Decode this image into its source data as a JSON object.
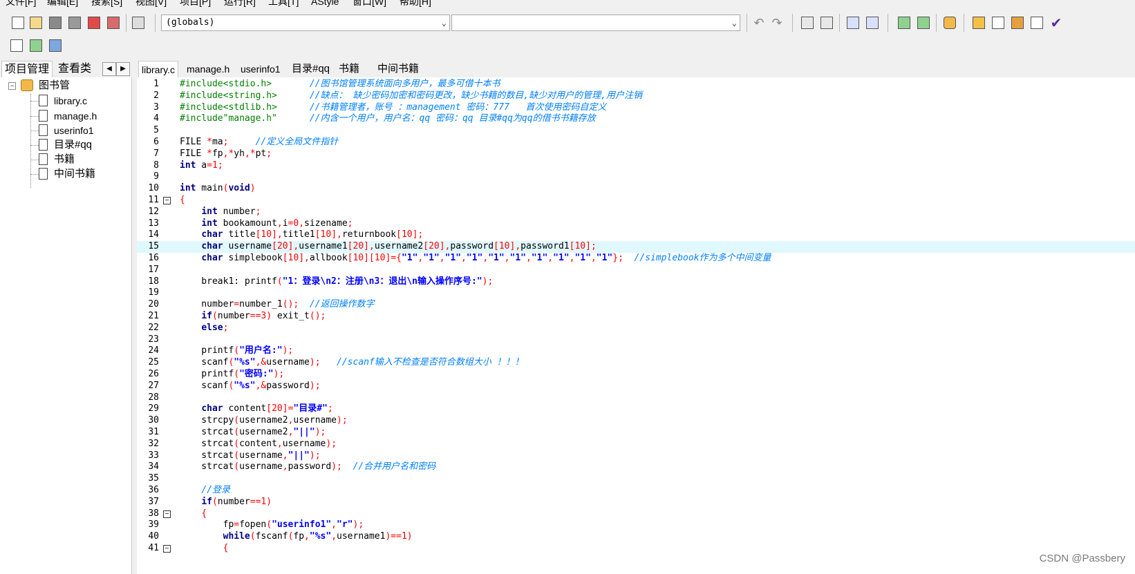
{
  "menu": [
    "文件[F]",
    "编辑[E]",
    "搜索[S]",
    "视图[V]",
    "项目[P]",
    "运行[R]",
    "工具[T]",
    "AStyle",
    "窗口[W]",
    "帮助[H]"
  ],
  "toolbar": {
    "scope_combo": "(globals)",
    "symbol_combo": ""
  },
  "left_panel": {
    "tabs": [
      "项目管理",
      "查看类"
    ],
    "nav_prev": "◀",
    "nav_next": "▶",
    "project_name": "图书管",
    "files": [
      "library.c",
      "manage.h",
      "userinfo1",
      "目录#qq",
      "书籍",
      "中间书籍"
    ]
  },
  "editor_tabs": [
    "library.c",
    "manage.h",
    "userinfo1",
    "目录#qq",
    "书籍",
    "中间书籍"
  ],
  "active_tab": "library.c",
  "code_lines": [
    "#include<stdio.h>       //图书馆管理系统面向多用户，最多可借十本书",
    "#include<string.h>      //缺点： 缺少密码加密和密码更改，缺少书籍的数目,缺少对用户的管理,用户注销",
    "#include<stdlib.h>      //书籍管理者，账号 ：management 密码：777   首次使用密码自定义",
    "#include\"manage.h\"      //内含一个用户，用户名：qq 密码：qq 目录#qq为qq的借书书籍存放",
    "",
    "FILE *ma;     //定义全局文件指针",
    "FILE *fp,*yh,*pt;",
    "int a=1;",
    "",
    "int main(void)",
    "{",
    "    int number;",
    "    int bookamount,i=0,sizename;",
    "    char title[10],title1[10],returnbook[10];",
    "    char username[20],username1[20],username2[20],password[10],password1[10];",
    "    char simplebook[10],allbook[10][10]={\"1\",\"1\",\"1\",\"1\",\"1\",\"1\",\"1\",\"1\",\"1\",\"1\"};  //simplebook作为多个中间变量",
    "",
    "    break1: printf(\"1：登录\\n2：注册\\n3：退出\\n输入操作序号:\");",
    "",
    "    number=number_1();  //返回操作数字",
    "    if(number==3) exit_t();",
    "    else;",
    "",
    "    printf(\"用户名:\");",
    "    scanf(\"%s\",&username);   //scanf输入不检查是否符合数组大小 ！！！",
    "    printf(\"密码:\");",
    "    scanf(\"%s\",&password);",
    "",
    "    char content[20]=\"目录#\";",
    "    strcpy(username2,username);",
    "    strcat(username2,\"||\");",
    "    strcat(content,username);",
    "    strcat(username,\"||\");",
    "    strcat(username,password);  //合并用户名和密码",
    "",
    "    //登录",
    "    if(number==1)",
    "    {",
    "        fp=fopen(\"userinfo1\",\"r\");",
    "        while(fscanf(fp,\"%s\",username1)==1)",
    "        {"
  ],
  "highlighted_line": 15,
  "fold_markers": [
    11,
    38,
    41
  ],
  "colors": {
    "keyword": "#000080",
    "preproc": "#008000",
    "comment": "#0080ff",
    "string": "#0000ff",
    "number": "#ff0000",
    "operator": "#ff0000",
    "highlight_bg": "#e0f8ff"
  },
  "watermark": "CSDN @Passbery"
}
